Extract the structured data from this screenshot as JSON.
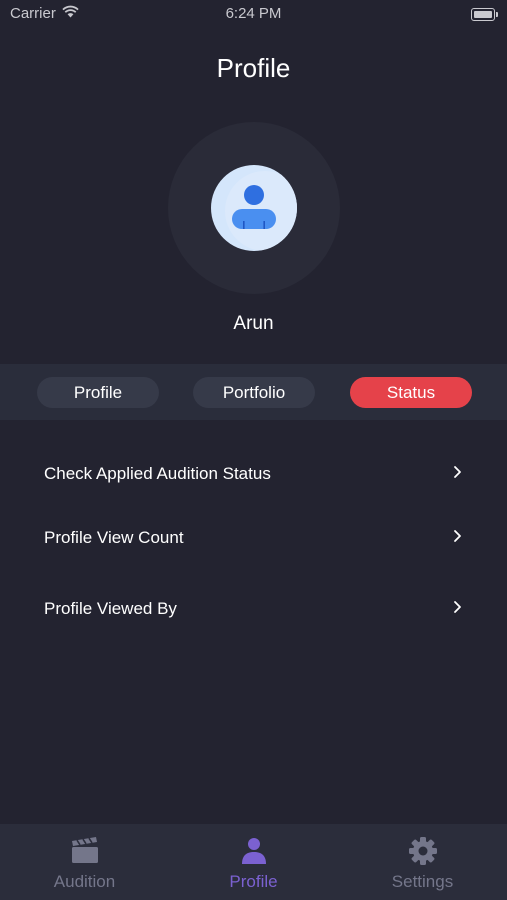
{
  "status_bar": {
    "carrier": "Carrier",
    "time": "6:24 PM"
  },
  "header": {
    "title": "Profile"
  },
  "user": {
    "name": "Arun"
  },
  "segments": [
    {
      "label": "Profile",
      "active": false
    },
    {
      "label": "Portfolio",
      "active": false
    },
    {
      "label": "Status",
      "active": true
    }
  ],
  "menu": [
    {
      "label": "Check Applied Audition Status"
    },
    {
      "label": "Profile View Count"
    },
    {
      "label": "Profile Viewed By"
    }
  ],
  "tab_bar": [
    {
      "label": "Audition",
      "icon": "clapperboard-icon",
      "active": false
    },
    {
      "label": "Profile",
      "icon": "person-icon",
      "active": true
    },
    {
      "label": "Settings",
      "icon": "gear-icon",
      "active": false
    }
  ],
  "colors": {
    "background": "#232330",
    "accent_red": "#e5424a",
    "accent_purple": "#7b61d1",
    "inactive": "#74768a"
  }
}
